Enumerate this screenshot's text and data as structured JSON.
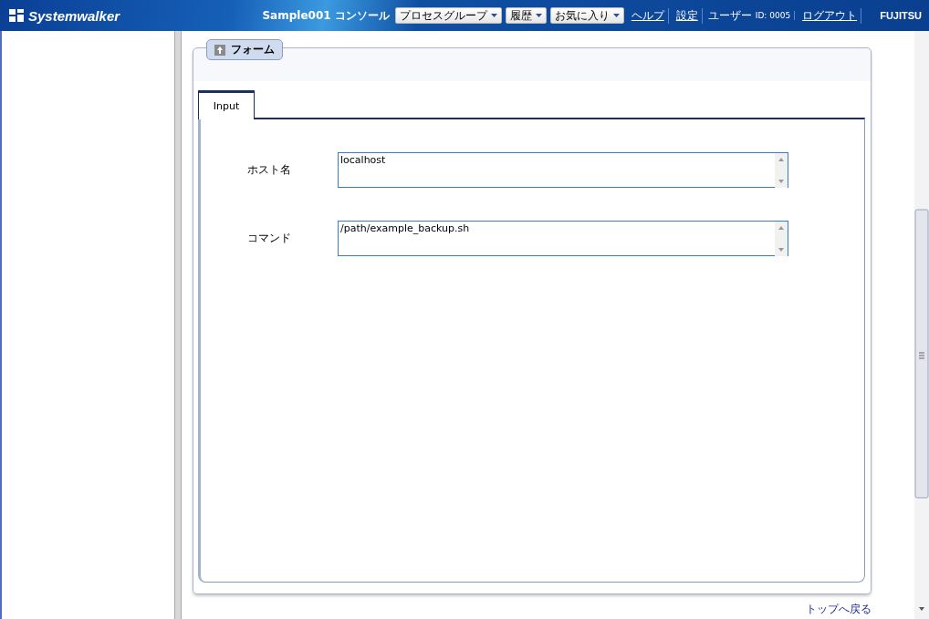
{
  "header": {
    "logo": "Systemwalker",
    "title": "Sample001 コンソール",
    "menus": [
      {
        "label": "プロセスグループ"
      },
      {
        "label": "履歴"
      },
      {
        "label": "お気に入り"
      }
    ],
    "links": [
      {
        "label": "ヘルプ",
        "kind": "link"
      },
      {
        "label": "設定",
        "kind": "link"
      },
      {
        "label": "ユーザー",
        "kind": "text"
      },
      {
        "label": "ID: 0005",
        "kind": "small"
      },
      {
        "label": "ログアウト",
        "kind": "link"
      }
    ],
    "brand": "FUJITSU"
  },
  "panel": {
    "legend": "フォーム",
    "tabs": [
      {
        "label": "Input",
        "selected": true
      }
    ],
    "fields": [
      {
        "label": "ホスト名",
        "value": "localhost"
      },
      {
        "label": "コマンド",
        "value": "/path/example_backup.sh"
      }
    ]
  },
  "footer_link": "トップへ戻る"
}
